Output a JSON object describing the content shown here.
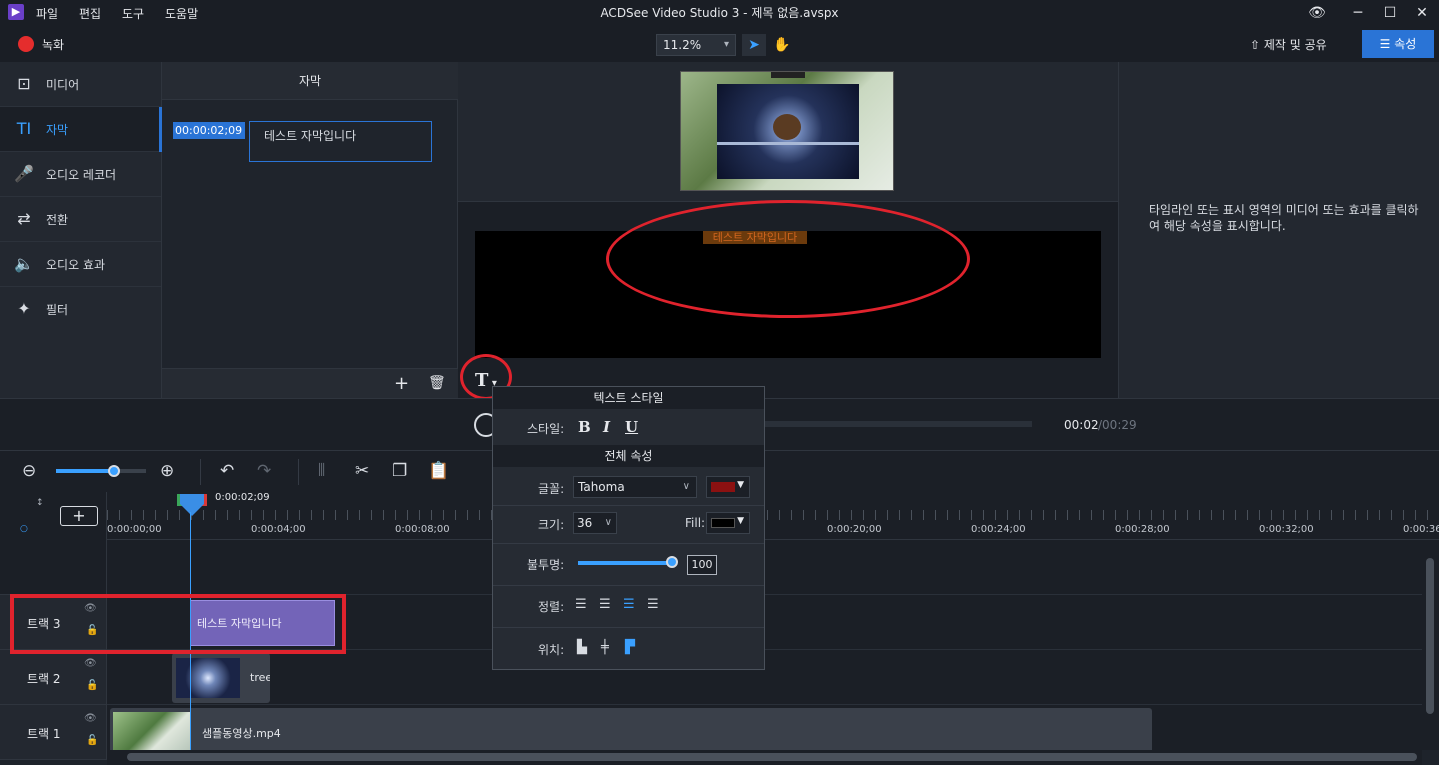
{
  "app": {
    "title": "ACDSee Video Studio 3 - 제목 없음.avspx"
  },
  "menu": [
    "파일",
    "편집",
    "도구",
    "도움말"
  ],
  "toolbar": {
    "record_label": "녹화",
    "zoom_value": "11.2%",
    "share_label": "제작 및 공유",
    "properties_label": "속성"
  },
  "nav": [
    {
      "label": "미디어",
      "icon": "media-icon",
      "active": false
    },
    {
      "label": "자막",
      "icon": "text-icon",
      "active": true
    },
    {
      "label": "오디오 레코더",
      "icon": "microphone-icon",
      "active": false
    },
    {
      "label": "전환",
      "icon": "transition-icon",
      "active": false
    },
    {
      "label": "오디오 효과",
      "icon": "speaker-icon",
      "active": false
    },
    {
      "label": "필터",
      "icon": "magic-wand-icon",
      "active": false
    }
  ],
  "subtitles": {
    "header": "자막",
    "items": [
      {
        "time": "00:00:02;09",
        "text": "테스트 자막입니다"
      }
    ]
  },
  "preview": {
    "overlay_text": "테스트 자막입니다"
  },
  "properties": {
    "hint": "타임라인 또는 표시 영역의 미디어 또는 효과를 클릭하여 해당 속성을 표시합니다."
  },
  "player": {
    "current": "00:02",
    "total": "/00:29"
  },
  "timeline": {
    "playhead_time": "0:00:02;09",
    "ticks": [
      "0:00:00;00",
      "0:00:04;00",
      "0:00:08;00",
      "0:00:20;00",
      "0:00:24;00",
      "0:00:28;00",
      "0:00:32;00",
      "0:00:36"
    ],
    "tracks": [
      {
        "name": "트랙 3",
        "clip": "테스트 자막입니다"
      },
      {
        "name": "트랙 2",
        "clip": "tree"
      },
      {
        "name": "트랙 1",
        "clip": "샘플동영상.mp4"
      }
    ]
  },
  "text_style_popup": {
    "title": "텍스트 스타일",
    "style_label": "스타일:",
    "bold": "B",
    "italic": "I",
    "underline": "U",
    "global_title": "전체 속성",
    "font_label": "글꼴:",
    "font_value": "Tahoma",
    "font_color": "#8b1111",
    "size_label": "크기:",
    "size_value": "36",
    "fill_label": "Fill:",
    "fill_color": "#000000",
    "opacity_label": "불투명:",
    "opacity_value": "100",
    "align_label": "정렬:",
    "position_label": "위치:"
  },
  "colors": {
    "accent": "#2a74d6",
    "annotation": "#e0232d",
    "subtitle_clip": "#7364b8"
  }
}
